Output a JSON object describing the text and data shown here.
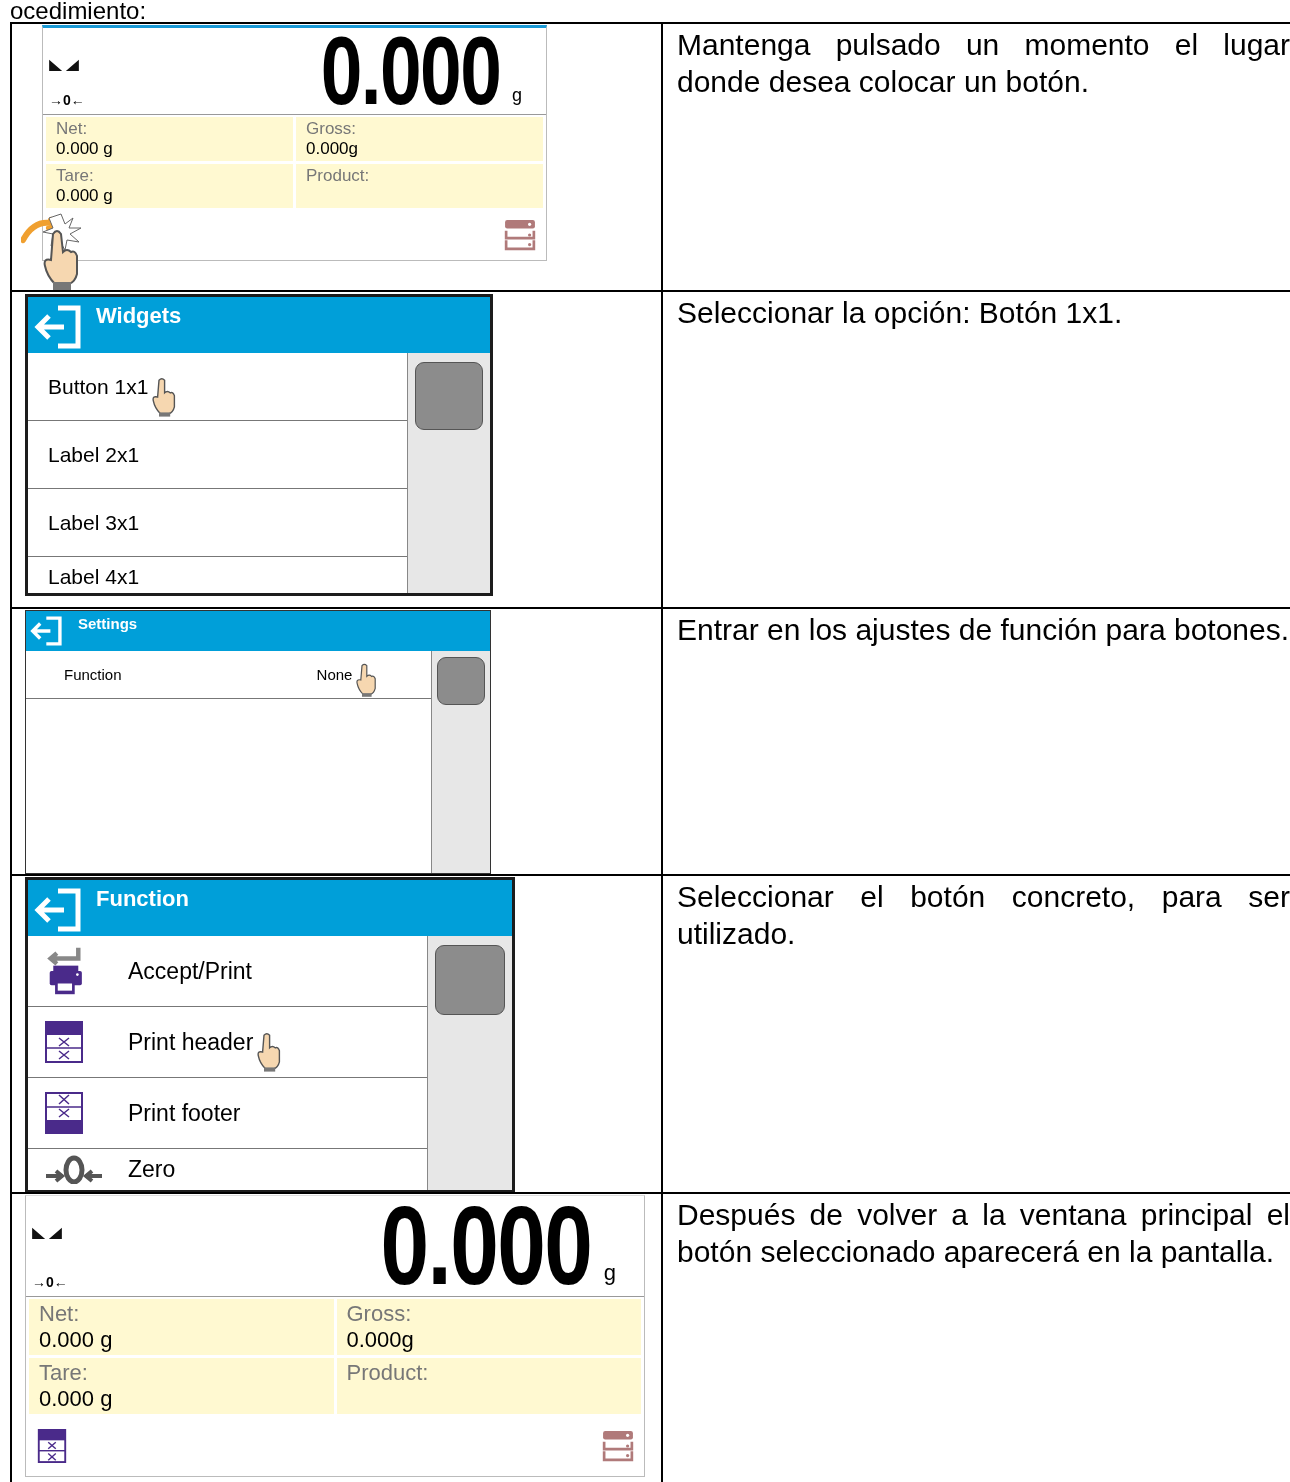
{
  "intro_fragment": "ocedimiento:",
  "steps": [
    {
      "screen": {
        "kind": "weighing",
        "reading": "0.000",
        "unit": "g",
        "zero_indicator": "→0←",
        "gesture": {
          "kind": "hold"
        },
        "fields": [
          {
            "label": "Net:",
            "value": "0.000 g"
          },
          {
            "label": "Gross:",
            "value": "0.000g"
          },
          {
            "label": "Tare:",
            "value": "0.000 g"
          },
          {
            "label": "Product:"
          }
        ],
        "footer_icons": [
          {
            "kind": "empty"
          },
          {
            "kind": "database"
          }
        ]
      },
      "instruction": "Mantenga pulsado un momento el lugar donde desea colocar un botón."
    },
    {
      "screen": {
        "kind": "menu",
        "title": "Widgets",
        "rows": [
          {
            "label": "Button 1x1",
            "pointer": true
          },
          {
            "label": "Label 2x1",
            "pointer": false
          },
          {
            "label": "Label 3x1",
            "pointer": false
          },
          {
            "label": "Label 4x1",
            "pointer": false
          }
        ]
      },
      "instruction": "Seleccionar la opción: Botón 1x1."
    },
    {
      "screen": {
        "kind": "menu",
        "title": "Settings",
        "rows": [
          {
            "label": "Function",
            "value": "None",
            "pointer": true
          }
        ]
      },
      "instruction": "Entrar en los ajustes de función para botones."
    },
    {
      "screen": {
        "kind": "menu",
        "title": "Function",
        "rows": [
          {
            "label": "Accept/Print",
            "kind": "accept_print",
            "pointer": false
          },
          {
            "label": "Print header",
            "kind": "print_header",
            "pointer": true
          },
          {
            "label": "Print footer",
            "kind": "print_footer",
            "pointer": false
          },
          {
            "label": "Zero",
            "kind": "zero",
            "pointer": false
          }
        ]
      },
      "instruction": "Seleccionar el botón concreto, para ser utilizado."
    },
    {
      "screen": {
        "kind": "weighing",
        "reading": "0.000",
        "unit": "g",
        "zero_indicator": "→0←",
        "fields": [
          {
            "label": "Net:",
            "value": "0.000 g"
          },
          {
            "label": "Gross:",
            "value": "0.000g"
          },
          {
            "label": "Tare:",
            "value": "0.000 g"
          },
          {
            "label": "Product:"
          }
        ],
        "footer_icons": [
          {
            "kind": "print_header"
          },
          {
            "kind": "database"
          }
        ]
      },
      "instruction": "Después de volver a la ventana principal el botón seleccionado aparecerá en la pantalla."
    }
  ]
}
